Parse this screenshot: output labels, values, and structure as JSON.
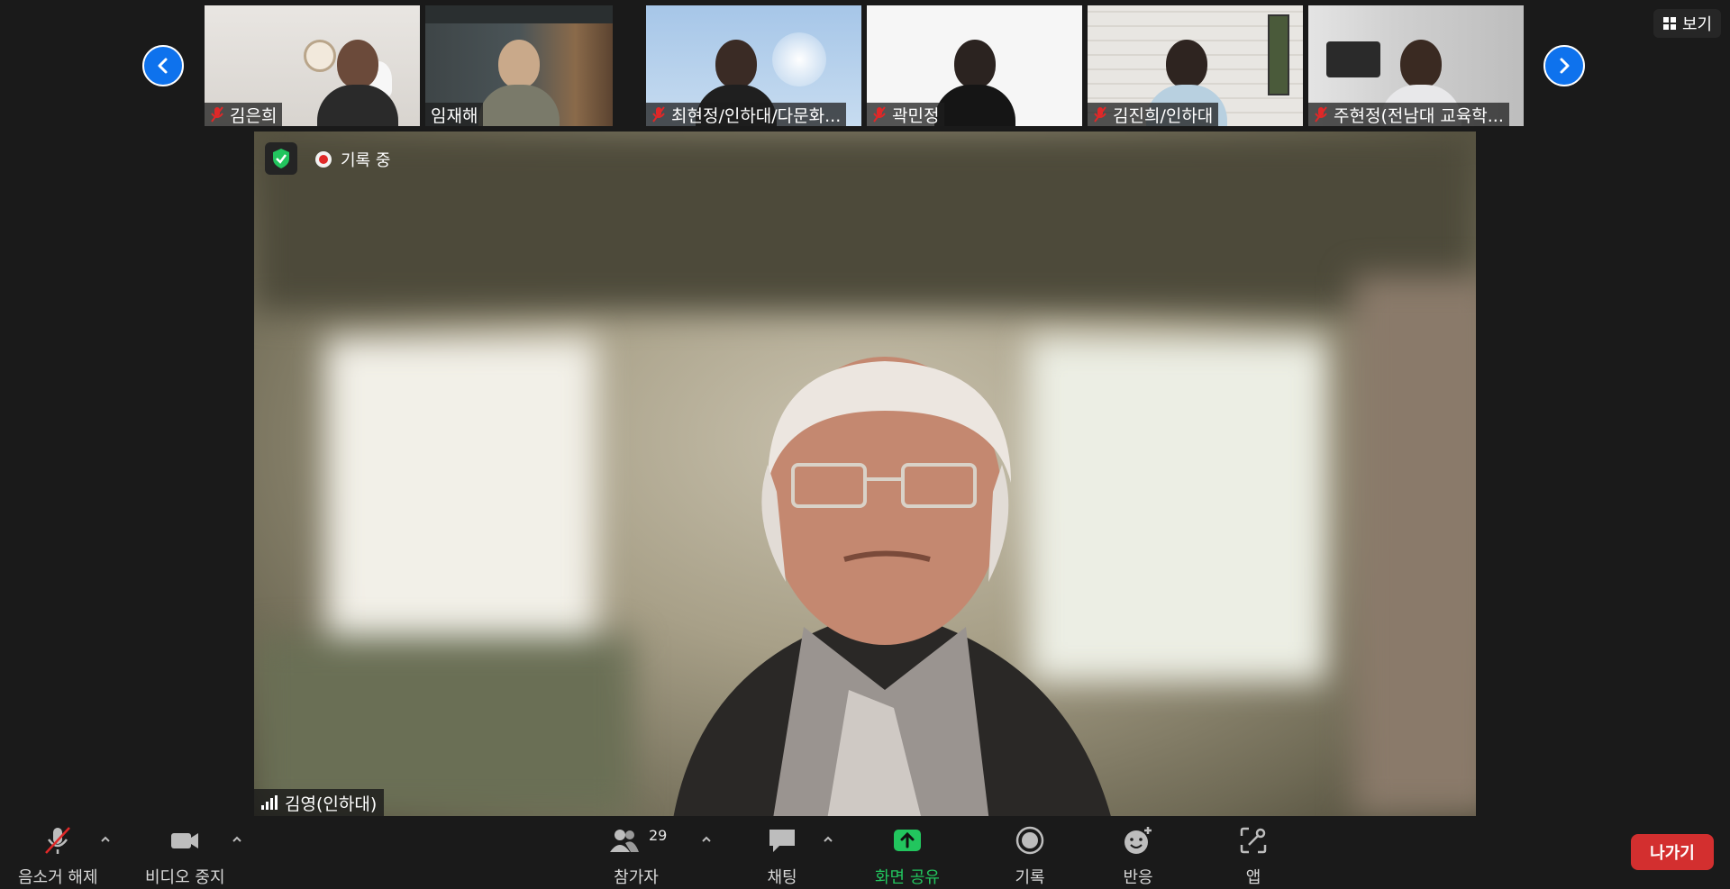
{
  "gallery": {
    "participants": [
      {
        "name": "김은희",
        "muted": true
      },
      {
        "name": "임재해",
        "muted": false
      },
      {
        "name": "최현정/인하대/다문화...",
        "muted": true
      },
      {
        "name": "곽민정",
        "muted": true
      },
      {
        "name": "김진희/인하대",
        "muted": true
      },
      {
        "name": "주현정(전남대 교육학...",
        "muted": true
      }
    ]
  },
  "view_button": {
    "label": "보기"
  },
  "main": {
    "recording_label": "기록 중",
    "speaker_name": "김영(인하대)"
  },
  "toolbar": {
    "unmute": "음소거 해제",
    "stop_video": "비디오 중지",
    "participants": "참가자",
    "participants_count": "29",
    "chat": "채팅",
    "share_screen": "화면 공유",
    "record": "기록",
    "reactions": "반응",
    "apps": "앱",
    "leave": "나가기"
  },
  "colors": {
    "accent_blue": "#0e72ed",
    "share_green": "#22c55e",
    "leave_red": "#d32f2f",
    "muted_red": "#e02828"
  }
}
